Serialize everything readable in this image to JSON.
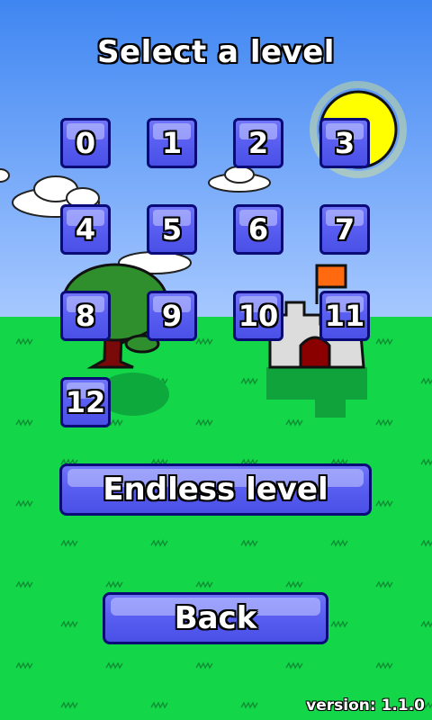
{
  "title": "Select a level",
  "levels": [
    "0",
    "1",
    "2",
    "3",
    "4",
    "5",
    "6",
    "7",
    "8",
    "9",
    "10",
    "11",
    "12"
  ],
  "endless_label": "Endless level",
  "back_label": "Back",
  "version": "version: 1.1.0",
  "colors": {
    "sky_top": "#3f86f2",
    "sky_bottom": "#a6c8ff",
    "grass": "#13d749",
    "button_fill": "#5a5ff2",
    "button_border": "#0b0b78",
    "sun": "#ffff00",
    "flag": "#ff6a10",
    "castle": "#dcdcdc",
    "door": "#8a0000",
    "tree_crown": "#2f8f2c",
    "tree_trunk": "#7a0a0a"
  }
}
